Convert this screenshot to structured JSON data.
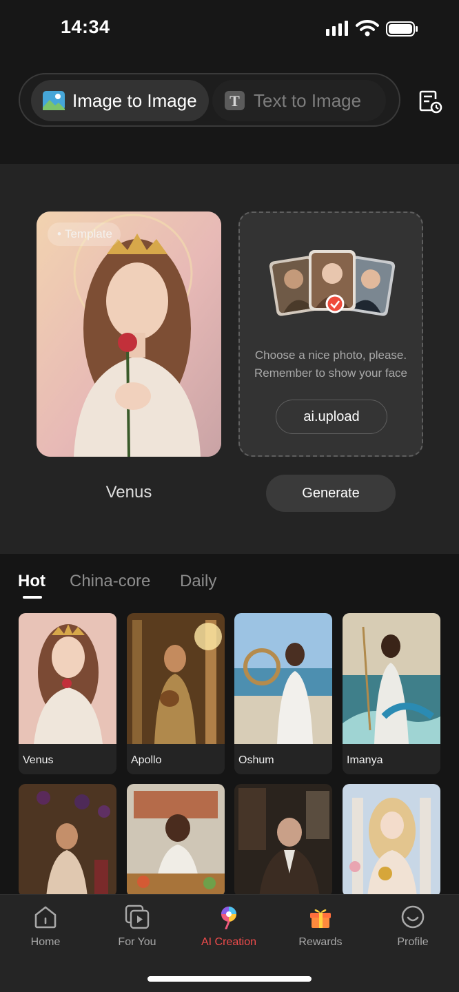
{
  "status_bar": {
    "time": "14:34"
  },
  "mode_switch": {
    "active_label": "Image to Image",
    "inactive_label": "Text to Image",
    "history_icon": "history-icon"
  },
  "creation": {
    "template_badge": "Template",
    "template_name": "Venus",
    "upload_hint_line1": "Choose a nice photo, please.",
    "upload_hint_line2": "Remember to show your face",
    "upload_button": "ai.upload",
    "generate_button": "Generate"
  },
  "categories": {
    "tabs": [
      "Hot",
      "China-core",
      "Daily"
    ],
    "active_tab": "Hot",
    "items": [
      {
        "name": "Venus"
      },
      {
        "name": "Apollo"
      },
      {
        "name": "Oshum"
      },
      {
        "name": "Imanya"
      },
      {
        "name": ""
      },
      {
        "name": ""
      },
      {
        "name": ""
      },
      {
        "name": ""
      }
    ]
  },
  "bottom_nav": {
    "items": [
      {
        "label": "Home",
        "icon": "home-icon"
      },
      {
        "label": "For You",
        "icon": "for-you-icon"
      },
      {
        "label": "AI Creation",
        "icon": "ai-creation-icon"
      },
      {
        "label": "Rewards",
        "icon": "gift-icon"
      },
      {
        "label": "Profile",
        "icon": "profile-icon"
      }
    ],
    "active": "AI Creation"
  },
  "colors": {
    "accent": "#f04c4c",
    "background": "#1a1a1a"
  }
}
